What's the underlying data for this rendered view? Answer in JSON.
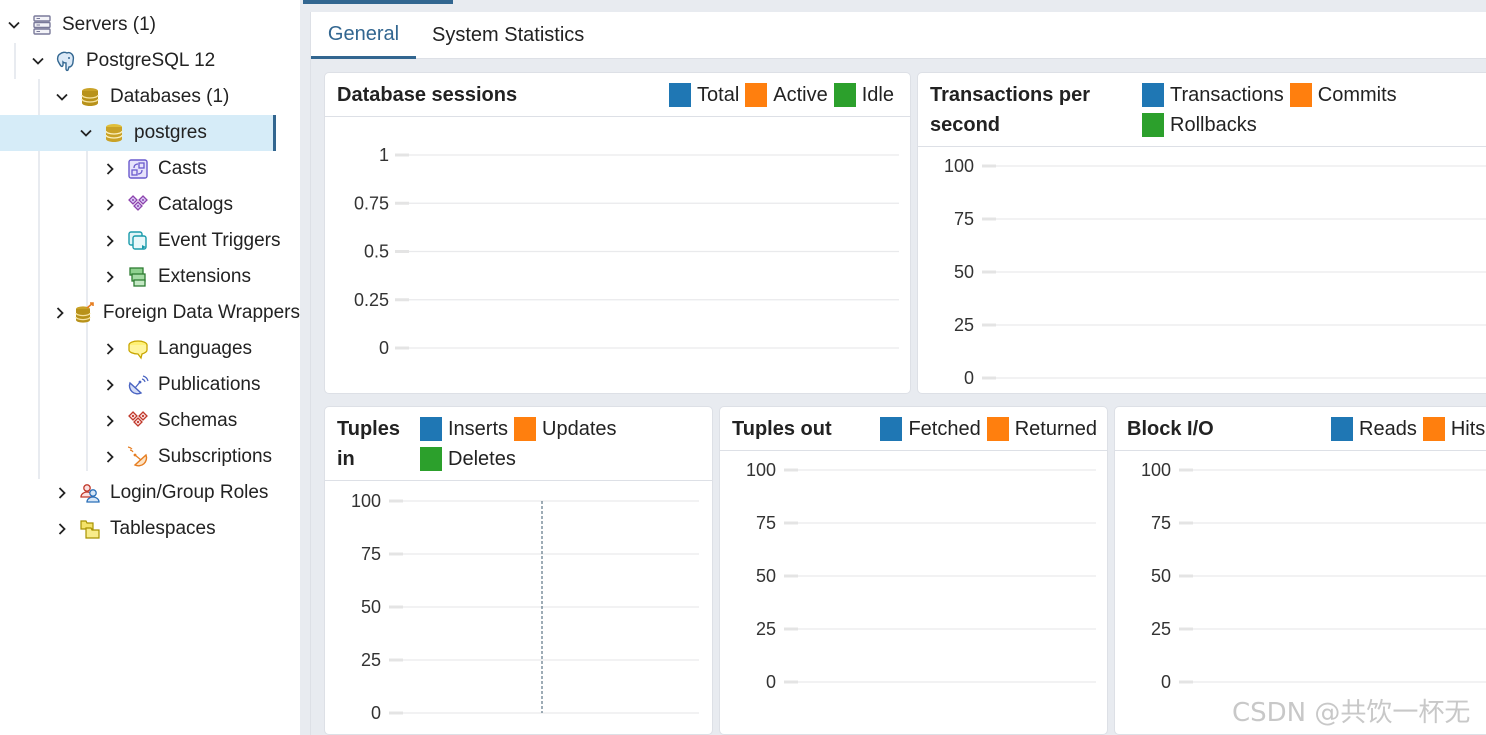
{
  "sidebar": {
    "tree": [
      {
        "label": "Servers (1)",
        "icon": "servers-icon",
        "expanded": true,
        "level": 0
      },
      {
        "label": "PostgreSQL 12",
        "icon": "postgresql-elephant-icon",
        "expanded": true,
        "level": 1
      },
      {
        "label": "Databases (1)",
        "icon": "databases-icon",
        "expanded": true,
        "level": 2
      },
      {
        "label": "postgres",
        "icon": "database-icon",
        "expanded": true,
        "level": 3,
        "selected": true
      },
      {
        "label": "Casts",
        "icon": "casts-icon",
        "expanded": false,
        "level": 4
      },
      {
        "label": "Catalogs",
        "icon": "catalogs-icon",
        "expanded": false,
        "level": 4
      },
      {
        "label": "Event Triggers",
        "icon": "event-triggers-icon",
        "expanded": false,
        "level": 4
      },
      {
        "label": "Extensions",
        "icon": "extensions-icon",
        "expanded": false,
        "level": 4
      },
      {
        "label": "Foreign Data Wrappers",
        "icon": "foreign-data-wrappers-icon",
        "expanded": false,
        "level": 4
      },
      {
        "label": "Languages",
        "icon": "languages-icon",
        "expanded": false,
        "level": 4
      },
      {
        "label": "Publications",
        "icon": "publications-icon",
        "expanded": false,
        "level": 4
      },
      {
        "label": "Schemas",
        "icon": "schemas-icon",
        "expanded": false,
        "level": 4
      },
      {
        "label": "Subscriptions",
        "icon": "subscriptions-icon",
        "expanded": false,
        "level": 4
      },
      {
        "label": "Login/Group Roles",
        "icon": "login-group-roles-icon",
        "expanded": false,
        "level": 2
      },
      {
        "label": "Tablespaces",
        "icon": "tablespaces-icon",
        "expanded": false,
        "level": 2
      }
    ]
  },
  "tabs": [
    {
      "label": "General",
      "active": true
    },
    {
      "label": "System Statistics",
      "active": false
    }
  ],
  "colors": {
    "accent": "#326690",
    "series_blue": "#1f77b4",
    "series_orange": "#ff7f0e",
    "series_green": "#2ca02c",
    "selected_bg": "#d6ecf8"
  },
  "chart_data": [
    {
      "id": "database-sessions",
      "type": "line",
      "title": "Database sessions",
      "series": [
        {
          "name": "Total",
          "color": "#1f77b4",
          "values": []
        },
        {
          "name": "Active",
          "color": "#ff7f0e",
          "values": []
        },
        {
          "name": "Idle",
          "color": "#2ca02c",
          "values": []
        }
      ],
      "yticks": [
        "1",
        "0.75",
        "0.5",
        "0.25",
        "0"
      ],
      "ylim": [
        0,
        1
      ],
      "grid": true,
      "legend": "top-right"
    },
    {
      "id": "transactions-per-second",
      "type": "line",
      "title": "Transactions per second",
      "series": [
        {
          "name": "Transactions",
          "color": "#1f77b4",
          "values": []
        },
        {
          "name": "Commits",
          "color": "#ff7f0e",
          "values": []
        },
        {
          "name": "Rollbacks",
          "color": "#2ca02c",
          "values": []
        }
      ],
      "yticks": [
        "100",
        "75",
        "50",
        "25",
        "0"
      ],
      "ylim": [
        0,
        100
      ],
      "grid": true,
      "legend": "top-right"
    },
    {
      "id": "tuples-in",
      "type": "line",
      "title": "Tuples in",
      "series": [
        {
          "name": "Inserts",
          "color": "#1f77b4",
          "values": []
        },
        {
          "name": "Updates",
          "color": "#ff7f0e",
          "values": []
        },
        {
          "name": "Deletes",
          "color": "#2ca02c",
          "values": []
        }
      ],
      "yticks": [
        "100",
        "75",
        "50",
        "25",
        "0"
      ],
      "ylim": [
        0,
        100
      ],
      "grid": true,
      "legend": "top-right",
      "cursor_line": true
    },
    {
      "id": "tuples-out",
      "type": "line",
      "title": "Tuples out",
      "series": [
        {
          "name": "Fetched",
          "color": "#1f77b4",
          "values": []
        },
        {
          "name": "Returned",
          "color": "#ff7f0e",
          "values": []
        }
      ],
      "yticks": [
        "100",
        "75",
        "50",
        "25",
        "0"
      ],
      "ylim": [
        0,
        100
      ],
      "grid": true,
      "legend": "top-right"
    },
    {
      "id": "block-io",
      "type": "line",
      "title": "Block I/O",
      "series": [
        {
          "name": "Reads",
          "color": "#1f77b4",
          "values": []
        },
        {
          "name": "Hits",
          "color": "#ff7f0e",
          "values": []
        }
      ],
      "yticks": [
        "100",
        "75",
        "50",
        "25",
        "0"
      ],
      "ylim": [
        0,
        100
      ],
      "grid": true,
      "legend": "top-right"
    }
  ],
  "watermark": "CSDN @共饮一杯无"
}
